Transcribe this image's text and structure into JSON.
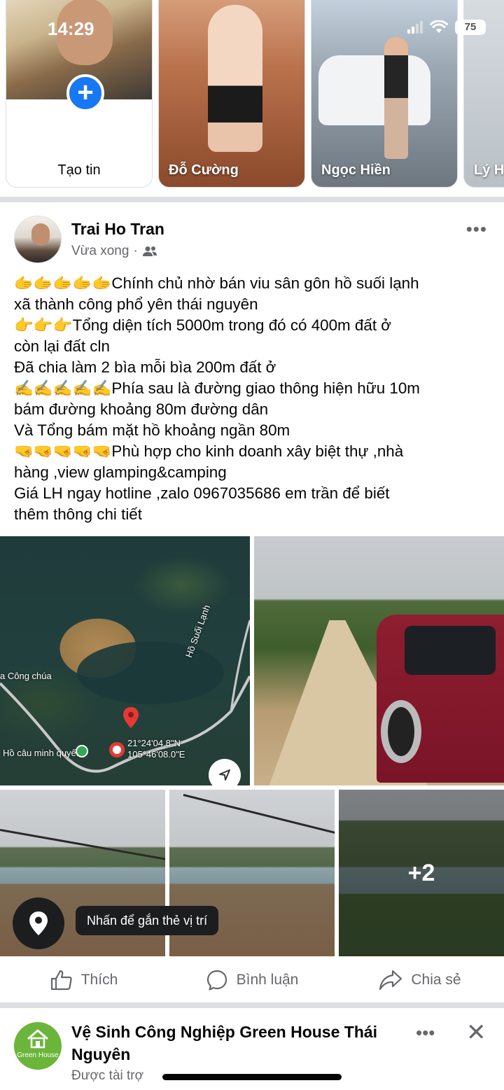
{
  "status_bar": {
    "time": "14:29",
    "battery": "75"
  },
  "stories": {
    "create_label": "Tạo tin",
    "items": [
      {
        "name": "Đỗ Cường"
      },
      {
        "name": "Ngọc Hiền"
      },
      {
        "name": "Lý H"
      }
    ]
  },
  "post": {
    "author": "Trai Ho Tran",
    "time": "Vừa xong",
    "audience_icon": "friends-icon",
    "more_label": "•••",
    "text_lines": [
      "🫱🫱🫱🫱🫱Chính chủ nhờ bán viu sân gôn hồ suối lạnh",
      "xã thành công phổ yên thái nguyên",
      "👉👉👉Tổng diện tích 5000m trong đó có 400m đất ở",
      "còn lại đất cln",
      "Đã chia làm 2 bìa mỗi bìa 200m đất ở",
      "✍️✍️✍️✍️✍️Phía sau là đường giao thông hiện hữu 10m",
      "bám đường khoảng 80m đường dân",
      "Và Tổng bám mặt hồ khoảng ngần 80m",
      "🤜🤜🤜🤜🤜Phù hợp cho kinh doanh xây biệt thự ,nhà",
      "hàng ,view glamping&camping",
      "Giá LH ngay hotline ,zalo 0967035686 em trần để biết",
      "thêm thông chi tiết"
    ],
    "map": {
      "labels": [
        "a Công chúa",
        "Hồ câu minh quyết",
        "Hồ Suối Lạnh"
      ],
      "coords_line1": "21°24'04.8\"N",
      "coords_line2": "105°46'08.0\"E"
    },
    "more_photos": "+2",
    "location_tip": "Nhấn để gắn thẻ vị trí",
    "actions": {
      "like": "Thích",
      "comment": "Bình luận",
      "share": "Chia sẻ"
    }
  },
  "sponsored": {
    "name": "Vệ Sinh Công Nghiệp Green House Thái Nguyên",
    "brand": "Green House",
    "label": "Được tài trợ",
    "more_label": "•••",
    "close_label": "✕"
  },
  "colors": {
    "brand_blue": "#1877f2",
    "text_secondary": "#65676b",
    "divider": "#dcdee2",
    "sponsor_green": "#6bb53a"
  }
}
